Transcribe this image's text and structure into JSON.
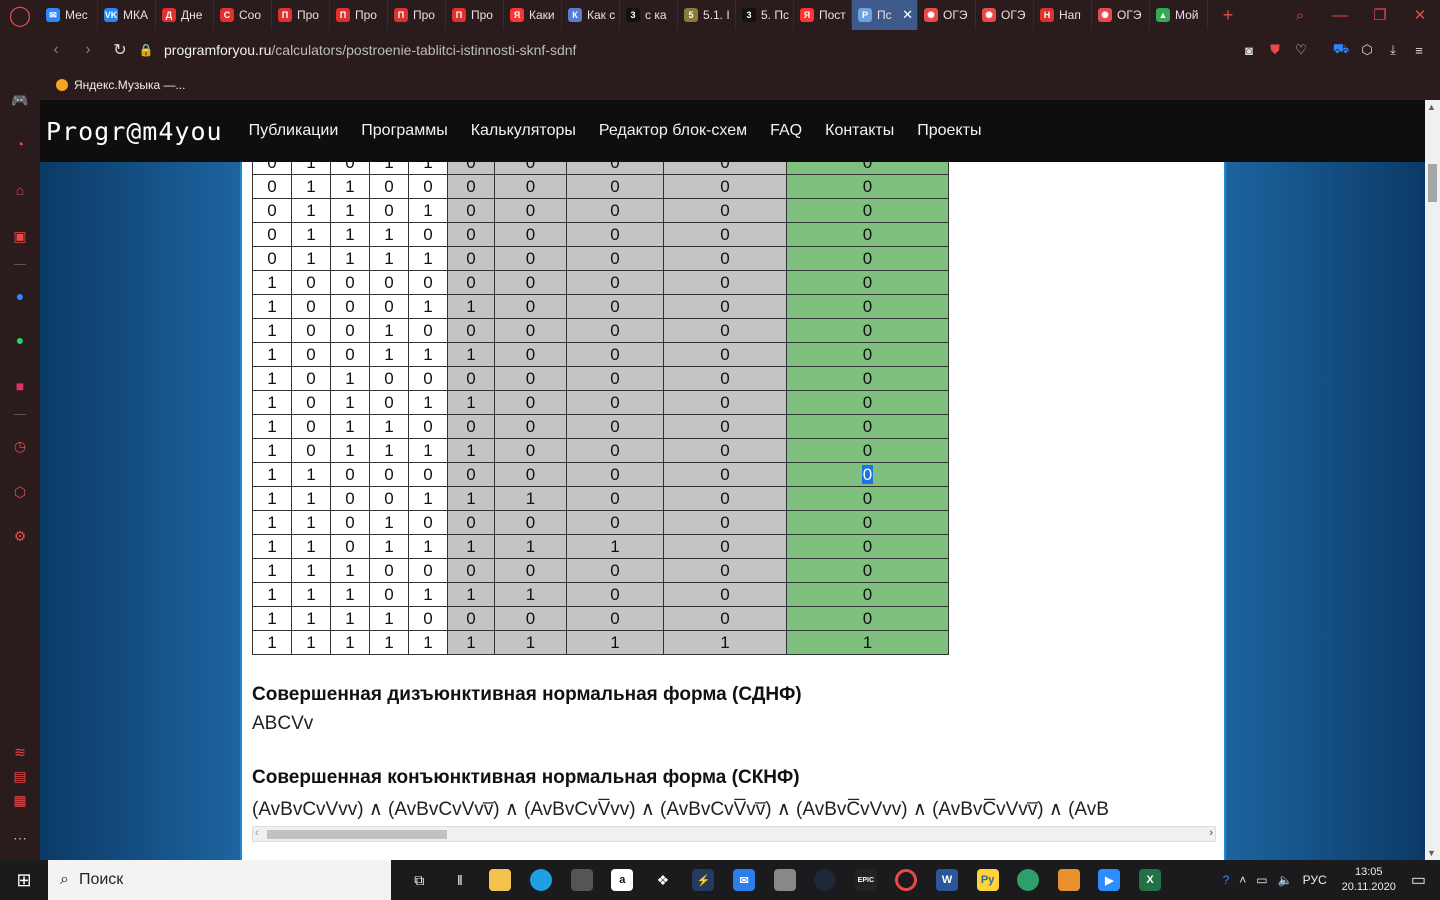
{
  "tabs": [
    {
      "label": "Мес",
      "color": "#2d88ff",
      "glyph": "✉"
    },
    {
      "label": "МКА",
      "color": "#2787f5",
      "glyph": "VK"
    },
    {
      "label": "Дне",
      "color": "#e03131",
      "glyph": "Д"
    },
    {
      "label": "Соо",
      "color": "#e03131",
      "glyph": "С"
    },
    {
      "label": "Про",
      "color": "#e03131",
      "glyph": "П"
    },
    {
      "label": "Про",
      "color": "#e03131",
      "glyph": "П"
    },
    {
      "label": "Про",
      "color": "#e03131",
      "glyph": "П"
    },
    {
      "label": "Про",
      "color": "#e03131",
      "glyph": "П"
    },
    {
      "label": "Каки",
      "color": "#ff3333",
      "glyph": "Я"
    },
    {
      "label": "Как с",
      "color": "#5a7bd6",
      "glyph": "К"
    },
    {
      "label": "с ка",
      "color": "#111111",
      "glyph": "3"
    },
    {
      "label": "5.1. І",
      "color": "#8b7a3a",
      "glyph": "5"
    },
    {
      "label": "5. Пс",
      "color": "#111111",
      "glyph": "3"
    },
    {
      "label": "Пост",
      "color": "#ff3333",
      "glyph": "Я"
    },
    {
      "label": "Пс",
      "color": "#6fa3e0",
      "glyph": "P",
      "active": true
    },
    {
      "label": "ОГЭ",
      "color": "#e84a4a",
      "glyph": "✺"
    },
    {
      "label": "ОГЭ",
      "color": "#e84a4a",
      "glyph": "✺"
    },
    {
      "label": "Нап",
      "color": "#e03131",
      "glyph": "Н"
    },
    {
      "label": "ОГЭ",
      "color": "#e84a4a",
      "glyph": "✺"
    },
    {
      "label": "Мой",
      "color": "#34a853",
      "glyph": "▲"
    }
  ],
  "browser": {
    "url_host": "programforyou.ru",
    "url_path": "/calculators/postroenie-tablitci-istinnosti-sknf-sdnf",
    "bookmark": "Яндекс.Музыка —..."
  },
  "site": {
    "logo": "Progr@m4you",
    "menu": [
      "Публикации",
      "Программы",
      "Калькуляторы",
      "Редактор блок-схем",
      "FAQ",
      "Контакты",
      "Проекты"
    ]
  },
  "truth_table": {
    "rows": [
      [
        "0",
        "1",
        "0",
        "1",
        "1",
        "0",
        "0",
        "0",
        "0",
        "0"
      ],
      [
        "0",
        "1",
        "1",
        "0",
        "0",
        "0",
        "0",
        "0",
        "0",
        "0"
      ],
      [
        "0",
        "1",
        "1",
        "0",
        "1",
        "0",
        "0",
        "0",
        "0",
        "0"
      ],
      [
        "0",
        "1",
        "1",
        "1",
        "0",
        "0",
        "0",
        "0",
        "0",
        "0"
      ],
      [
        "0",
        "1",
        "1",
        "1",
        "1",
        "0",
        "0",
        "0",
        "0",
        "0"
      ],
      [
        "1",
        "0",
        "0",
        "0",
        "0",
        "0",
        "0",
        "0",
        "0",
        "0"
      ],
      [
        "1",
        "0",
        "0",
        "0",
        "1",
        "1",
        "0",
        "0",
        "0",
        "0"
      ],
      [
        "1",
        "0",
        "0",
        "1",
        "0",
        "0",
        "0",
        "0",
        "0",
        "0"
      ],
      [
        "1",
        "0",
        "0",
        "1",
        "1",
        "1",
        "0",
        "0",
        "0",
        "0"
      ],
      [
        "1",
        "0",
        "1",
        "0",
        "0",
        "0",
        "0",
        "0",
        "0",
        "0"
      ],
      [
        "1",
        "0",
        "1",
        "0",
        "1",
        "1",
        "0",
        "0",
        "0",
        "0"
      ],
      [
        "1",
        "0",
        "1",
        "1",
        "0",
        "0",
        "0",
        "0",
        "0",
        "0"
      ],
      [
        "1",
        "0",
        "1",
        "1",
        "1",
        "1",
        "0",
        "0",
        "0",
        "0"
      ],
      [
        "1",
        "1",
        "0",
        "0",
        "0",
        "0",
        "0",
        "0",
        "0",
        "0"
      ],
      [
        "1",
        "1",
        "0",
        "0",
        "1",
        "1",
        "1",
        "0",
        "0",
        "0"
      ],
      [
        "1",
        "1",
        "0",
        "1",
        "0",
        "0",
        "0",
        "0",
        "0",
        "0"
      ],
      [
        "1",
        "1",
        "0",
        "1",
        "1",
        "1",
        "1",
        "1",
        "0",
        "0"
      ],
      [
        "1",
        "1",
        "1",
        "0",
        "0",
        "0",
        "0",
        "0",
        "0",
        "0"
      ],
      [
        "1",
        "1",
        "1",
        "0",
        "1",
        "1",
        "1",
        "0",
        "0",
        "0"
      ],
      [
        "1",
        "1",
        "1",
        "1",
        "0",
        "0",
        "0",
        "0",
        "0",
        "0"
      ],
      [
        "1",
        "1",
        "1",
        "1",
        "1",
        "1",
        "1",
        "1",
        "1",
        "1"
      ]
    ],
    "selected_row": 13
  },
  "sdnf": {
    "heading": "Совершенная дизъюнктивная нормальная форма (СДНФ)",
    "value": "ABCVv"
  },
  "sknf": {
    "heading": "Совершенная конъюнктивная нормальная форма (СКНФ)",
    "value": "(AvBvCvVvv) ∧ (AvBvCvVvv̅) ∧ (AvBvCvV̅vv) ∧ (AvBvCvV̅vv̅) ∧ (AvBvC̅vVvv) ∧ (AvBvC̅vVvv̅) ∧ (AvB"
  },
  "taskbar": {
    "search_placeholder": "Поиск",
    "lang": "РУС",
    "time": "13:05",
    "date": "20.11.2020"
  }
}
